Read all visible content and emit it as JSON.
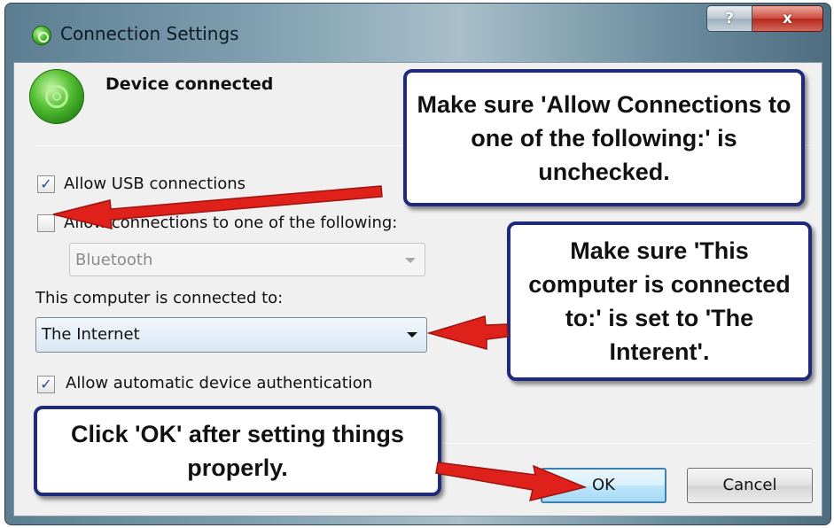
{
  "window": {
    "title": "Connection Settings",
    "help_button": "?",
    "close_button": "x"
  },
  "device": {
    "status": "Device connected",
    "icon": "device-connected-icon"
  },
  "options": {
    "allow_usb": {
      "label": "Allow USB connections",
      "checked": true
    },
    "allow_following": {
      "label": "Allow connections to one of the following:",
      "checked": false
    },
    "following_select": {
      "value": "Bluetooth",
      "enabled": false
    },
    "connected_to_label": "This computer is connected to:",
    "connected_to_select": {
      "value": "The Internet",
      "enabled": true
    },
    "auto_auth": {
      "label": "Allow automatic device authentication",
      "checked": true
    }
  },
  "buttons": {
    "ok": "OK",
    "cancel": "Cancel"
  },
  "callouts": {
    "allow_connections": "Make sure 'Allow Connections to one of the following:' is unchecked.",
    "connected_to": "Make sure 'This computer is connected to:' is set to 'The Interent'.",
    "click_ok": "Click 'OK' after setting things properly."
  },
  "colors": {
    "callout_border": "#1f2a7a",
    "arrow": "#e0201a",
    "default_button_border": "#3c7fb1"
  }
}
